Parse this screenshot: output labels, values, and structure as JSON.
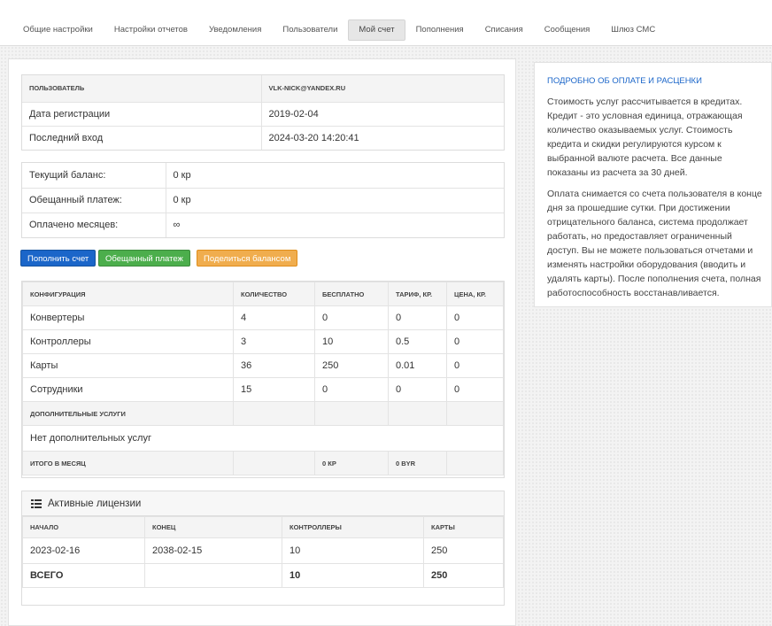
{
  "tabs": [
    {
      "label": "Общие настройки",
      "active": false
    },
    {
      "label": "Настройки отчетов",
      "active": false
    },
    {
      "label": "Уведомления",
      "active": false
    },
    {
      "label": "Пользователи",
      "active": false
    },
    {
      "label": "Мой счет",
      "active": true
    },
    {
      "label": "Пополнения",
      "active": false
    },
    {
      "label": "Списания",
      "active": false
    },
    {
      "label": "Сообщения",
      "active": false
    },
    {
      "label": "Шлюз СМС",
      "active": false
    }
  ],
  "user_info": {
    "header_label": "ПОЛЬЗОВАТЕЛЬ",
    "header_value": "VLK-NICK@YANDEX.RU",
    "rows": [
      {
        "label": "Дата регистрации",
        "value": "2019-02-04"
      },
      {
        "label": "Последний вход",
        "value": "2024-03-20 14:20:41"
      }
    ]
  },
  "balance": {
    "rows": [
      {
        "label": "Текущий баланс:",
        "value": "0 кр"
      },
      {
        "label": "Обещанный платеж:",
        "value": "0 кр"
      },
      {
        "label": "Оплачено месяцев:",
        "value": "∞"
      }
    ]
  },
  "buttons": {
    "topup": "Пополнить счет",
    "promised": "Обещанный платеж",
    "share": "Поделиться балансом",
    "colors": {
      "topup": "#1b66c9",
      "promised": "#4cae4c",
      "share": "#f0ad4e"
    }
  },
  "config": {
    "headers": [
      "КОНФИГУРАЦИЯ",
      "КОЛИЧЕСТВО",
      "БЕСПЛАТНО",
      "ТАРИФ, КР.",
      "ЦЕНА, КР."
    ],
    "rows": [
      [
        "Конвертеры",
        "4",
        "0",
        "0",
        "0"
      ],
      [
        "Контроллеры",
        "3",
        "10",
        "0.5",
        "0"
      ],
      [
        "Карты",
        "36",
        "250",
        "0.01",
        "0"
      ],
      [
        "Сотрудники",
        "15",
        "0",
        "0",
        "0"
      ]
    ],
    "extra_header": "ДОПОЛНИТЕЛЬНЫЕ УСЛУГИ",
    "extra_empty": "Нет дополнительных услуг",
    "total_label": "ИТОГО В МЕСЯЦ",
    "total_credits": "0 КР",
    "total_byr": "0 BYR"
  },
  "licenses": {
    "title": "Активные лицензии",
    "icon": "list-icon",
    "headers": [
      "НАЧАЛО",
      "КОНЕЦ",
      "КОНТРОЛЛЕРЫ",
      "КАРТЫ"
    ],
    "rows": [
      [
        "2023-02-16",
        "2038-02-15",
        "10",
        "250"
      ]
    ],
    "total": [
      "ВСЕГО",
      "",
      "10",
      "250"
    ]
  },
  "info": {
    "title": "ПОДРОБНО ОБ ОПЛАТЕ И РАСЦЕНКИ",
    "p1": "Стоимость услуг рассчитывается в кредитах. Кредит - это условная единица, отражающая количество оказываемых услуг. Стоимость кредита и скидки регулируются курсом к выбранной валюте расчета. Все данные показаны из расчета за 30 дней.",
    "p2": "Оплата снимается со счета пользователя в конце дня за прошедшие сутки. При достижении отрицательного баланса, система продолжает работать, но предоставляет ограниченный доступ. Вы не можете пользоваться отчетами и изменять настройки оборудования (вводить и удалять карты). После пополнения счета, полная работоспособность восстанавливается."
  }
}
